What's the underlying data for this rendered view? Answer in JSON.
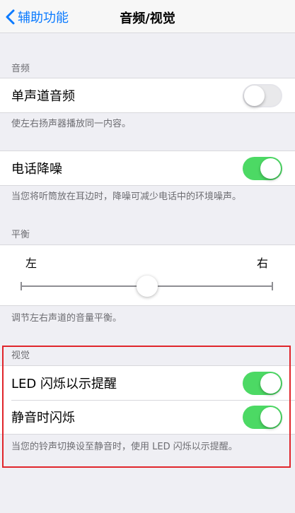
{
  "navbar": {
    "back_label": "辅助功能",
    "title": "音频/视觉"
  },
  "audio": {
    "header": "音频",
    "mono": {
      "label": "单声道音频",
      "on": false
    },
    "mono_note": "使左右扬声器播放同一内容。",
    "noise": {
      "label": "电话降噪",
      "on": true
    },
    "noise_note": "当您将听筒放在耳边时，降噪可减少电话中的环境噪声。"
  },
  "balance": {
    "header": "平衡",
    "left_label": "左",
    "right_label": "右",
    "value": 0.5,
    "note": "调节左右声道的音量平衡。"
  },
  "visual": {
    "header": "视觉",
    "led": {
      "label": "LED 闪烁以示提醒",
      "on": true
    },
    "silent": {
      "label": "静音时闪烁",
      "on": true
    },
    "note": "当您的铃声切换设至静音时，使用 LED 闪烁以示提醒。"
  },
  "colors": {
    "accent": "#0a7aff",
    "toggle_on": "#4cd964",
    "highlight": "#e0252b"
  }
}
